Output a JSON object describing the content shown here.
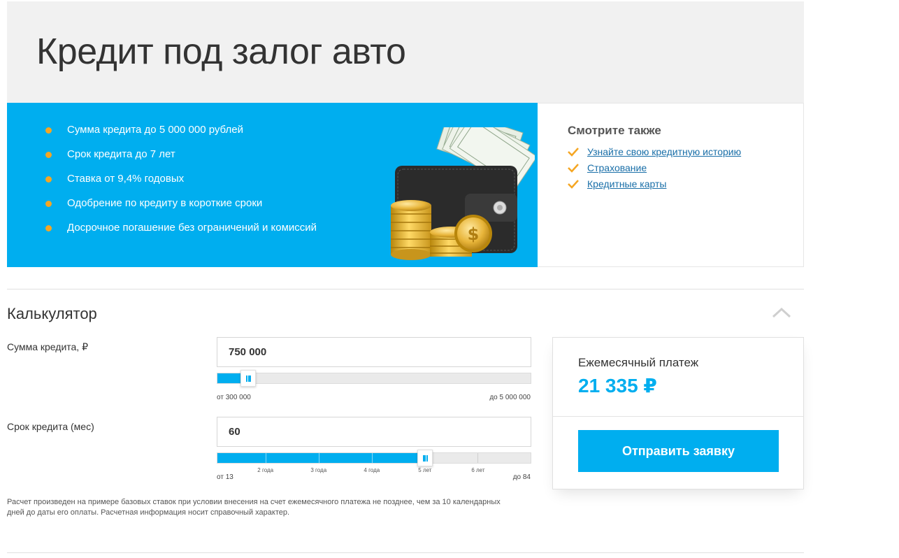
{
  "header": {
    "title": "Кредит под залог авто"
  },
  "promo": {
    "features": [
      "Сумма кредита до 5 000 000 рублей",
      "Срок кредита до 7 лет",
      "Ставка от 9,4% годовых",
      "Одобрение по кредиту в короткие сроки",
      "Досрочное погашение без ограничений и комиссий"
    ],
    "background_color": "#00aeef",
    "bullet_color": "#f5a623"
  },
  "see_also": {
    "title": "Смотрите также",
    "links": [
      "Узнайте свою кредитную историю",
      "Страхование",
      "Кредитные карты"
    ]
  },
  "calculator": {
    "title": "Калькулятор",
    "amount": {
      "label": "Сумма кредита, ₽",
      "value": "750 000",
      "min_label": "от 300 000",
      "max_label": "до 5 000 000",
      "min": 300000,
      "max": 5000000,
      "current": 750000
    },
    "term": {
      "label": "Срок кредита (мес)",
      "value": "60",
      "min_label": "от 13",
      "max_label": "до 84",
      "min": 13,
      "max": 84,
      "current": 60,
      "ticks": [
        {
          "label": "2 года",
          "months": 24
        },
        {
          "label": "3 года",
          "months": 36
        },
        {
          "label": "4 года",
          "months": 48
        },
        {
          "label": "5 лет",
          "months": 60
        },
        {
          "label": "6 лет",
          "months": 72
        }
      ]
    },
    "disclaimer": "Расчет произведен на примере базовых ставок при условии внесения на счет ежемесячного платежа не позднее, чем за 10 календарных дней до даты его оплаты. Расчетная информация носит справочный характер."
  },
  "result": {
    "label": "Ежемесячный платеж",
    "amount": "21 335 ₽",
    "submit_label": "Отправить заявку",
    "accent_color": "#00aeef"
  }
}
